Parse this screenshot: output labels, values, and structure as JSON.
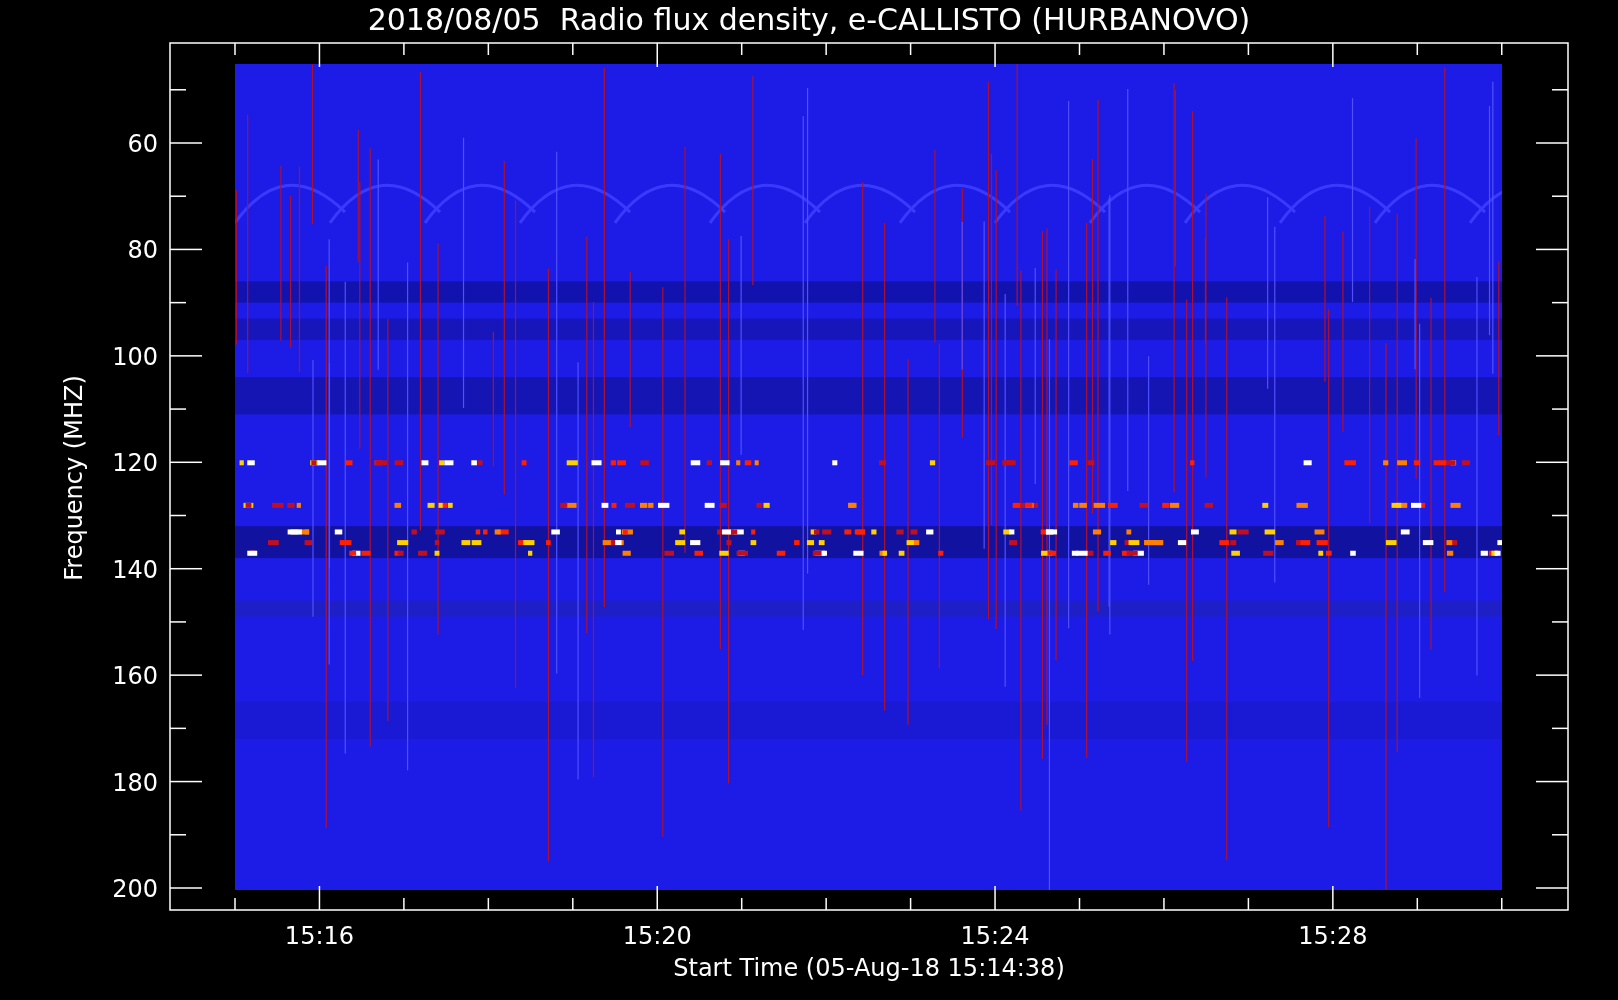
{
  "title": "2018/08/05  Radio flux density, e-CALLISTO (HURBANOVO)",
  "y_axis": {
    "label": "Frequency (MHZ)",
    "ticks": [
      "60",
      "80",
      "100",
      "120",
      "140",
      "160",
      "180",
      "200"
    ]
  },
  "x_axis": {
    "label": "Start Time (05-Aug-18 15:14:38)",
    "ticks": [
      "15:16",
      "15:20",
      "15:24",
      "15:28"
    ]
  }
}
